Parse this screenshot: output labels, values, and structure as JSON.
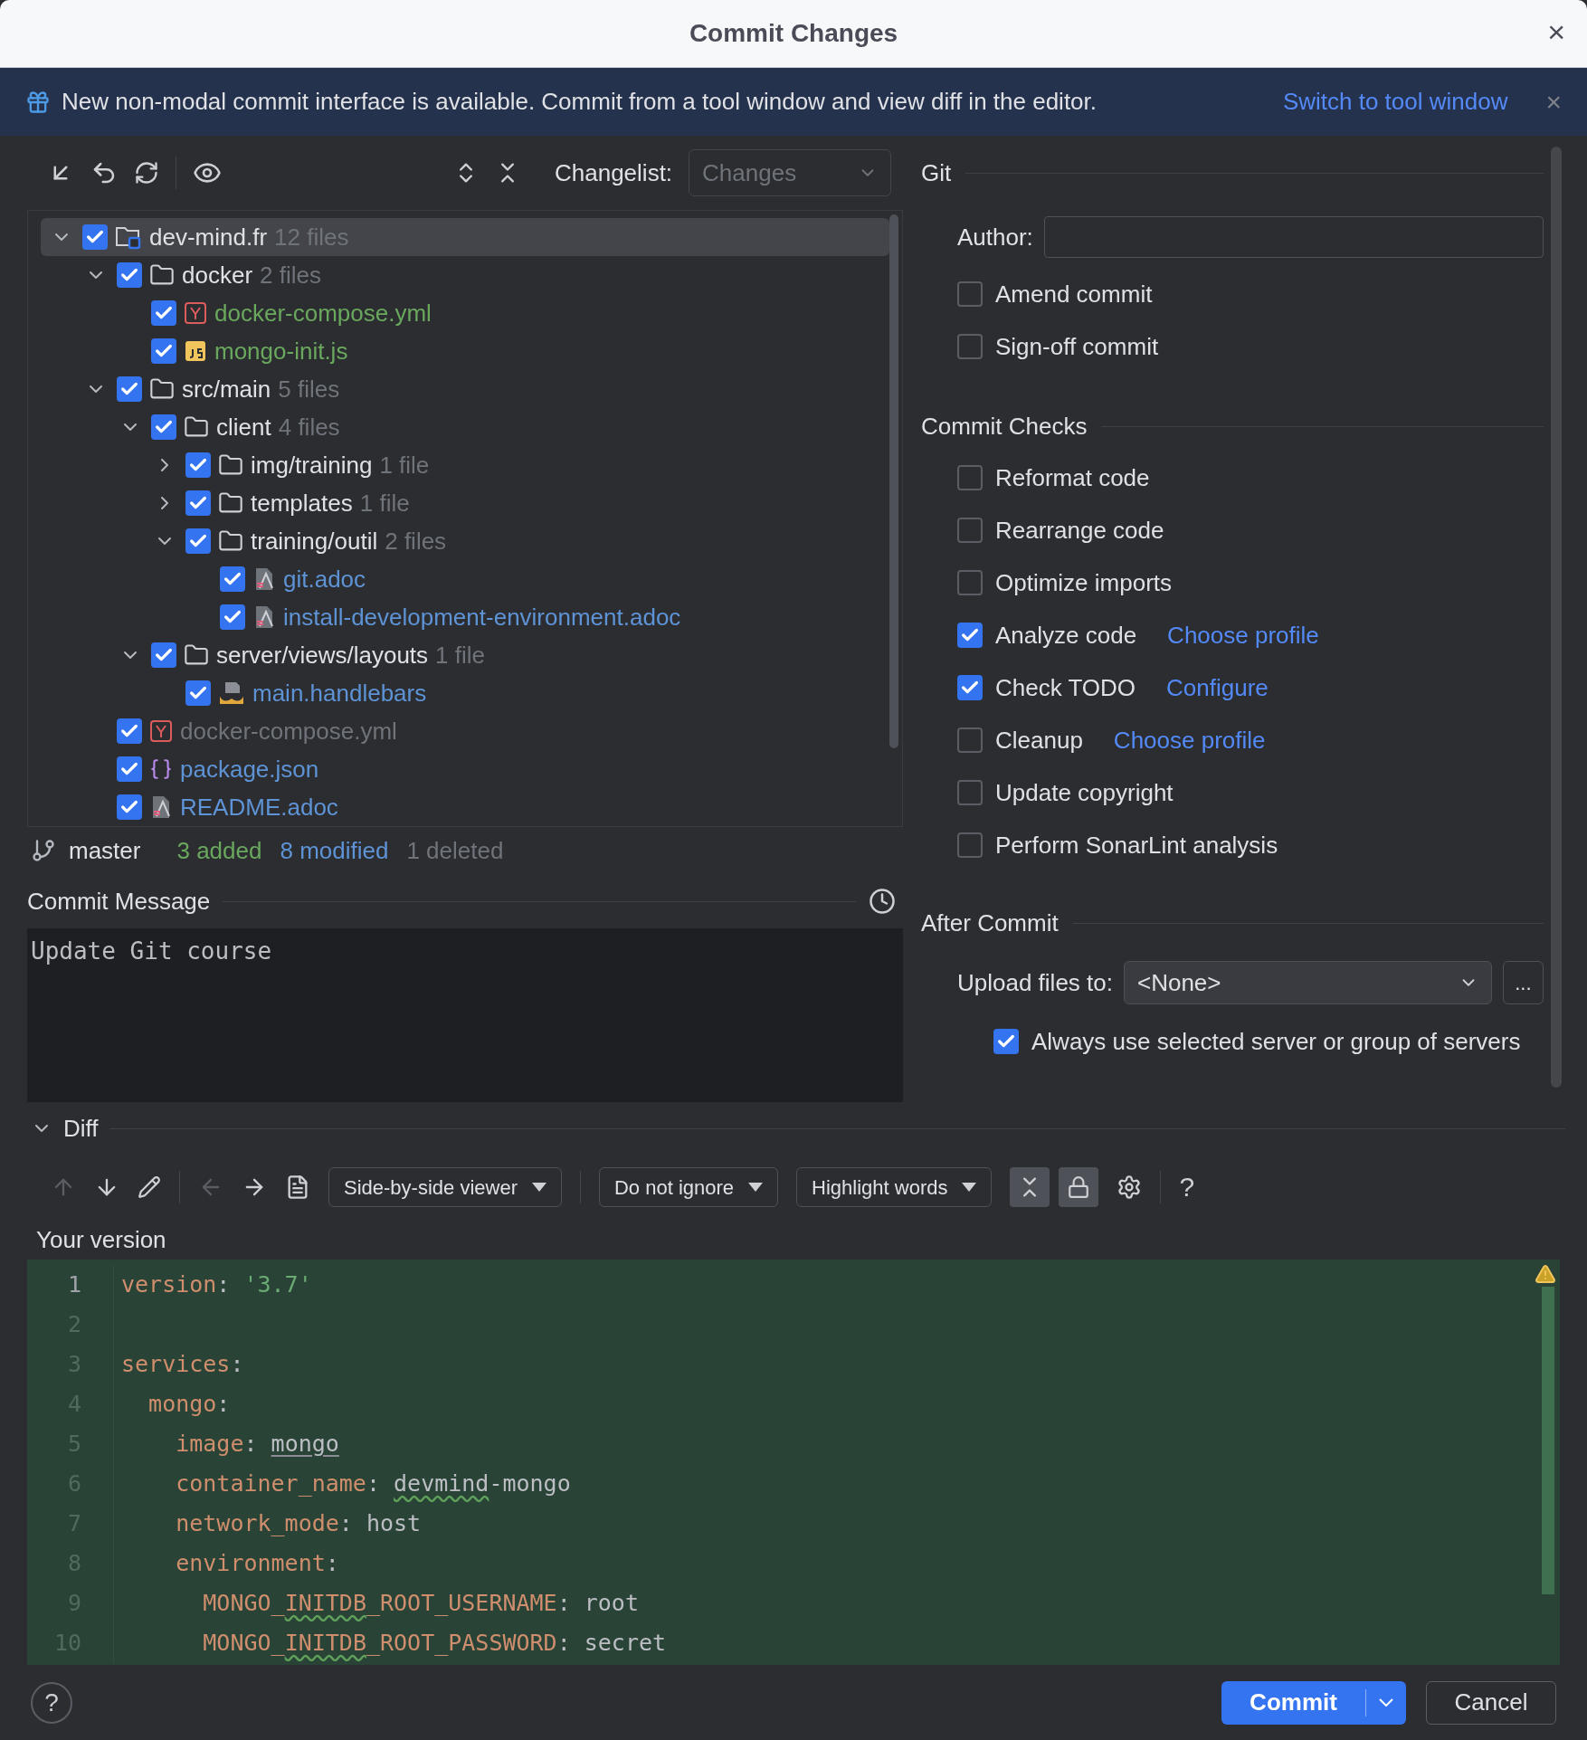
{
  "window": {
    "title": "Commit Changes",
    "close": "×"
  },
  "banner": {
    "text": "New non-modal commit interface is available. Commit from a tool window and view diff in the editor.",
    "link": "Switch to tool window",
    "close": "×"
  },
  "changelist": {
    "label": "Changelist:",
    "value": "Changes"
  },
  "tree": [
    {
      "name": "dev-mind.fr",
      "count": "12 files",
      "kind": "module",
      "checked": true,
      "expanded": true,
      "selected": true,
      "children": [
        {
          "name": "docker",
          "count": "2 files",
          "kind": "folder",
          "checked": true,
          "expanded": true,
          "selected": false,
          "children": [
            {
              "name": "docker-compose.yml",
              "kind": "yaml",
              "color": "#6aa85e",
              "checked": true,
              "selected": false
            },
            {
              "name": "mongo-init.js",
              "kind": "js",
              "color": "#6aa85e",
              "checked": true,
              "selected": false
            }
          ]
        },
        {
          "name": "src/main",
          "count": "5 files",
          "kind": "folder",
          "checked": true,
          "expanded": true,
          "selected": false,
          "children": [
            {
              "name": "client",
              "count": "4 files",
              "kind": "folder",
              "checked": true,
              "expanded": true,
              "selected": false,
              "children": [
                {
                  "name": "img/training",
                  "count": "1 file",
                  "kind": "folder",
                  "checked": true,
                  "expanded": false,
                  "selected": false
                },
                {
                  "name": "templates",
                  "count": "1 file",
                  "kind": "folder",
                  "checked": true,
                  "expanded": false,
                  "selected": false
                },
                {
                  "name": "training/outil",
                  "count": "2 files",
                  "kind": "folder",
                  "checked": true,
                  "expanded": true,
                  "selected": false,
                  "children": [
                    {
                      "name": "git.adoc",
                      "kind": "adoc",
                      "color": "#5e93d6",
                      "checked": true,
                      "selected": false
                    },
                    {
                      "name": "install-development-environment.adoc",
                      "kind": "adoc",
                      "color": "#5e93d6",
                      "checked": true,
                      "selected": false
                    }
                  ]
                }
              ]
            },
            {
              "name": "server/views/layouts",
              "count": "1 file",
              "kind": "folder",
              "checked": true,
              "expanded": true,
              "selected": false,
              "children": [
                {
                  "name": "main.handlebars",
                  "kind": "handlebars",
                  "color": "#5e93d6",
                  "checked": true,
                  "selected": false
                }
              ]
            }
          ]
        },
        {
          "name": "docker-compose.yml",
          "kind": "yaml",
          "color": "#6f737a",
          "checked": true,
          "selected": false
        },
        {
          "name": "package.json",
          "kind": "json",
          "color": "#5e93d6",
          "checked": true,
          "selected": false
        },
        {
          "name": "README.adoc",
          "kind": "adoc",
          "color": "#5e93d6",
          "checked": true,
          "selected": false
        }
      ]
    }
  ],
  "status_bar": {
    "branch": "master",
    "counts": [
      {
        "text": "3 added",
        "color": "#6aa85e"
      },
      {
        "text": "8 modified",
        "color": "#5e93d6"
      },
      {
        "text": "1 deleted",
        "color": "#6f737a"
      }
    ]
  },
  "commit_message": {
    "label": "Commit Message",
    "value": "Update Git course"
  },
  "git": {
    "title": "Git",
    "author_label": "Author:",
    "options": [
      {
        "label": "Amend commit",
        "checked": false
      },
      {
        "label": "Sign-off commit",
        "checked": false
      }
    ]
  },
  "commit_checks": {
    "title": "Commit Checks",
    "options": [
      {
        "label": "Reformat code",
        "checked": false
      },
      {
        "label": "Rearrange code",
        "checked": false
      },
      {
        "label": "Optimize imports",
        "checked": false
      },
      {
        "label": "Analyze code",
        "checked": true,
        "link": "Choose profile"
      },
      {
        "label": "Check TODO",
        "checked": true,
        "link": "Configure"
      },
      {
        "label": "Cleanup",
        "checked": false,
        "link": "Choose profile"
      },
      {
        "label": "Update copyright",
        "checked": false
      },
      {
        "label": "Perform SonarLint analysis",
        "checked": false
      }
    ]
  },
  "after_commit": {
    "title": "After Commit",
    "upload_label": "Upload files to:",
    "upload_value": "<None>",
    "browse": "...",
    "always_use": {
      "label": "Always use selected server or group of servers",
      "checked": true
    }
  },
  "diff": {
    "title": "Diff",
    "expanded": true,
    "viewer": "Side-by-side viewer",
    "ignore": "Do not ignore",
    "highlight": "Highlight words",
    "collapse_on": true,
    "lock_on": true,
    "help": "?",
    "pane_title": "Your version",
    "lines": [
      {
        "number": "1",
        "tokens": [
          {
            "kind": "key",
            "text": "version"
          },
          {
            "kind": "punct",
            "text": ": "
          },
          {
            "kind": "string",
            "text": "'3.7'"
          }
        ]
      },
      {
        "number": "2"
      },
      {
        "number": "3",
        "tokens": [
          {
            "kind": "key",
            "text": "services"
          },
          {
            "kind": "punct",
            "text": ":"
          }
        ]
      },
      {
        "number": "4",
        "tokens": [
          {
            "kind": "key",
            "text": "  mongo"
          },
          {
            "kind": "punct",
            "text": ":"
          }
        ]
      },
      {
        "number": "5",
        "tokens": [
          {
            "kind": "key",
            "text": "    image"
          },
          {
            "kind": "punct",
            "text": ": "
          },
          {
            "kind": "link",
            "text": "mongo"
          }
        ]
      },
      {
        "number": "6",
        "tokens": [
          {
            "kind": "key",
            "text": "    container_name"
          },
          {
            "kind": "punct",
            "text": ": "
          },
          {
            "kind": "typo",
            "text": "devmind"
          },
          {
            "kind": "value",
            "text": "-mongo"
          }
        ]
      },
      {
        "number": "7",
        "tokens": [
          {
            "kind": "key",
            "text": "    network_mode"
          },
          {
            "kind": "punct",
            "text": ": "
          },
          {
            "kind": "value",
            "text": "host"
          }
        ]
      },
      {
        "number": "8",
        "tokens": [
          {
            "kind": "key",
            "text": "    environment"
          },
          {
            "kind": "punct",
            "text": ":"
          }
        ]
      },
      {
        "number": "9",
        "tokens": [
          {
            "kind": "key",
            "text": "      MONGO_"
          },
          {
            "kind": "key_typo",
            "text": "INITDB"
          },
          {
            "kind": "key",
            "text": "_ROOT_USERNAME"
          },
          {
            "kind": "punct",
            "text": ": "
          },
          {
            "kind": "value",
            "text": "root"
          }
        ]
      },
      {
        "number": "10",
        "tokens": [
          {
            "kind": "key",
            "text": "      MONGO_"
          },
          {
            "kind": "key_typo",
            "text": "INITDB"
          },
          {
            "kind": "key",
            "text": "_ROOT_PASSWORD"
          },
          {
            "kind": "punct",
            "text": ": "
          },
          {
            "kind": "value",
            "text": "secret"
          }
        ]
      }
    ]
  },
  "footer": {
    "help": "?",
    "commit": "Commit",
    "cancel": "Cancel"
  }
}
